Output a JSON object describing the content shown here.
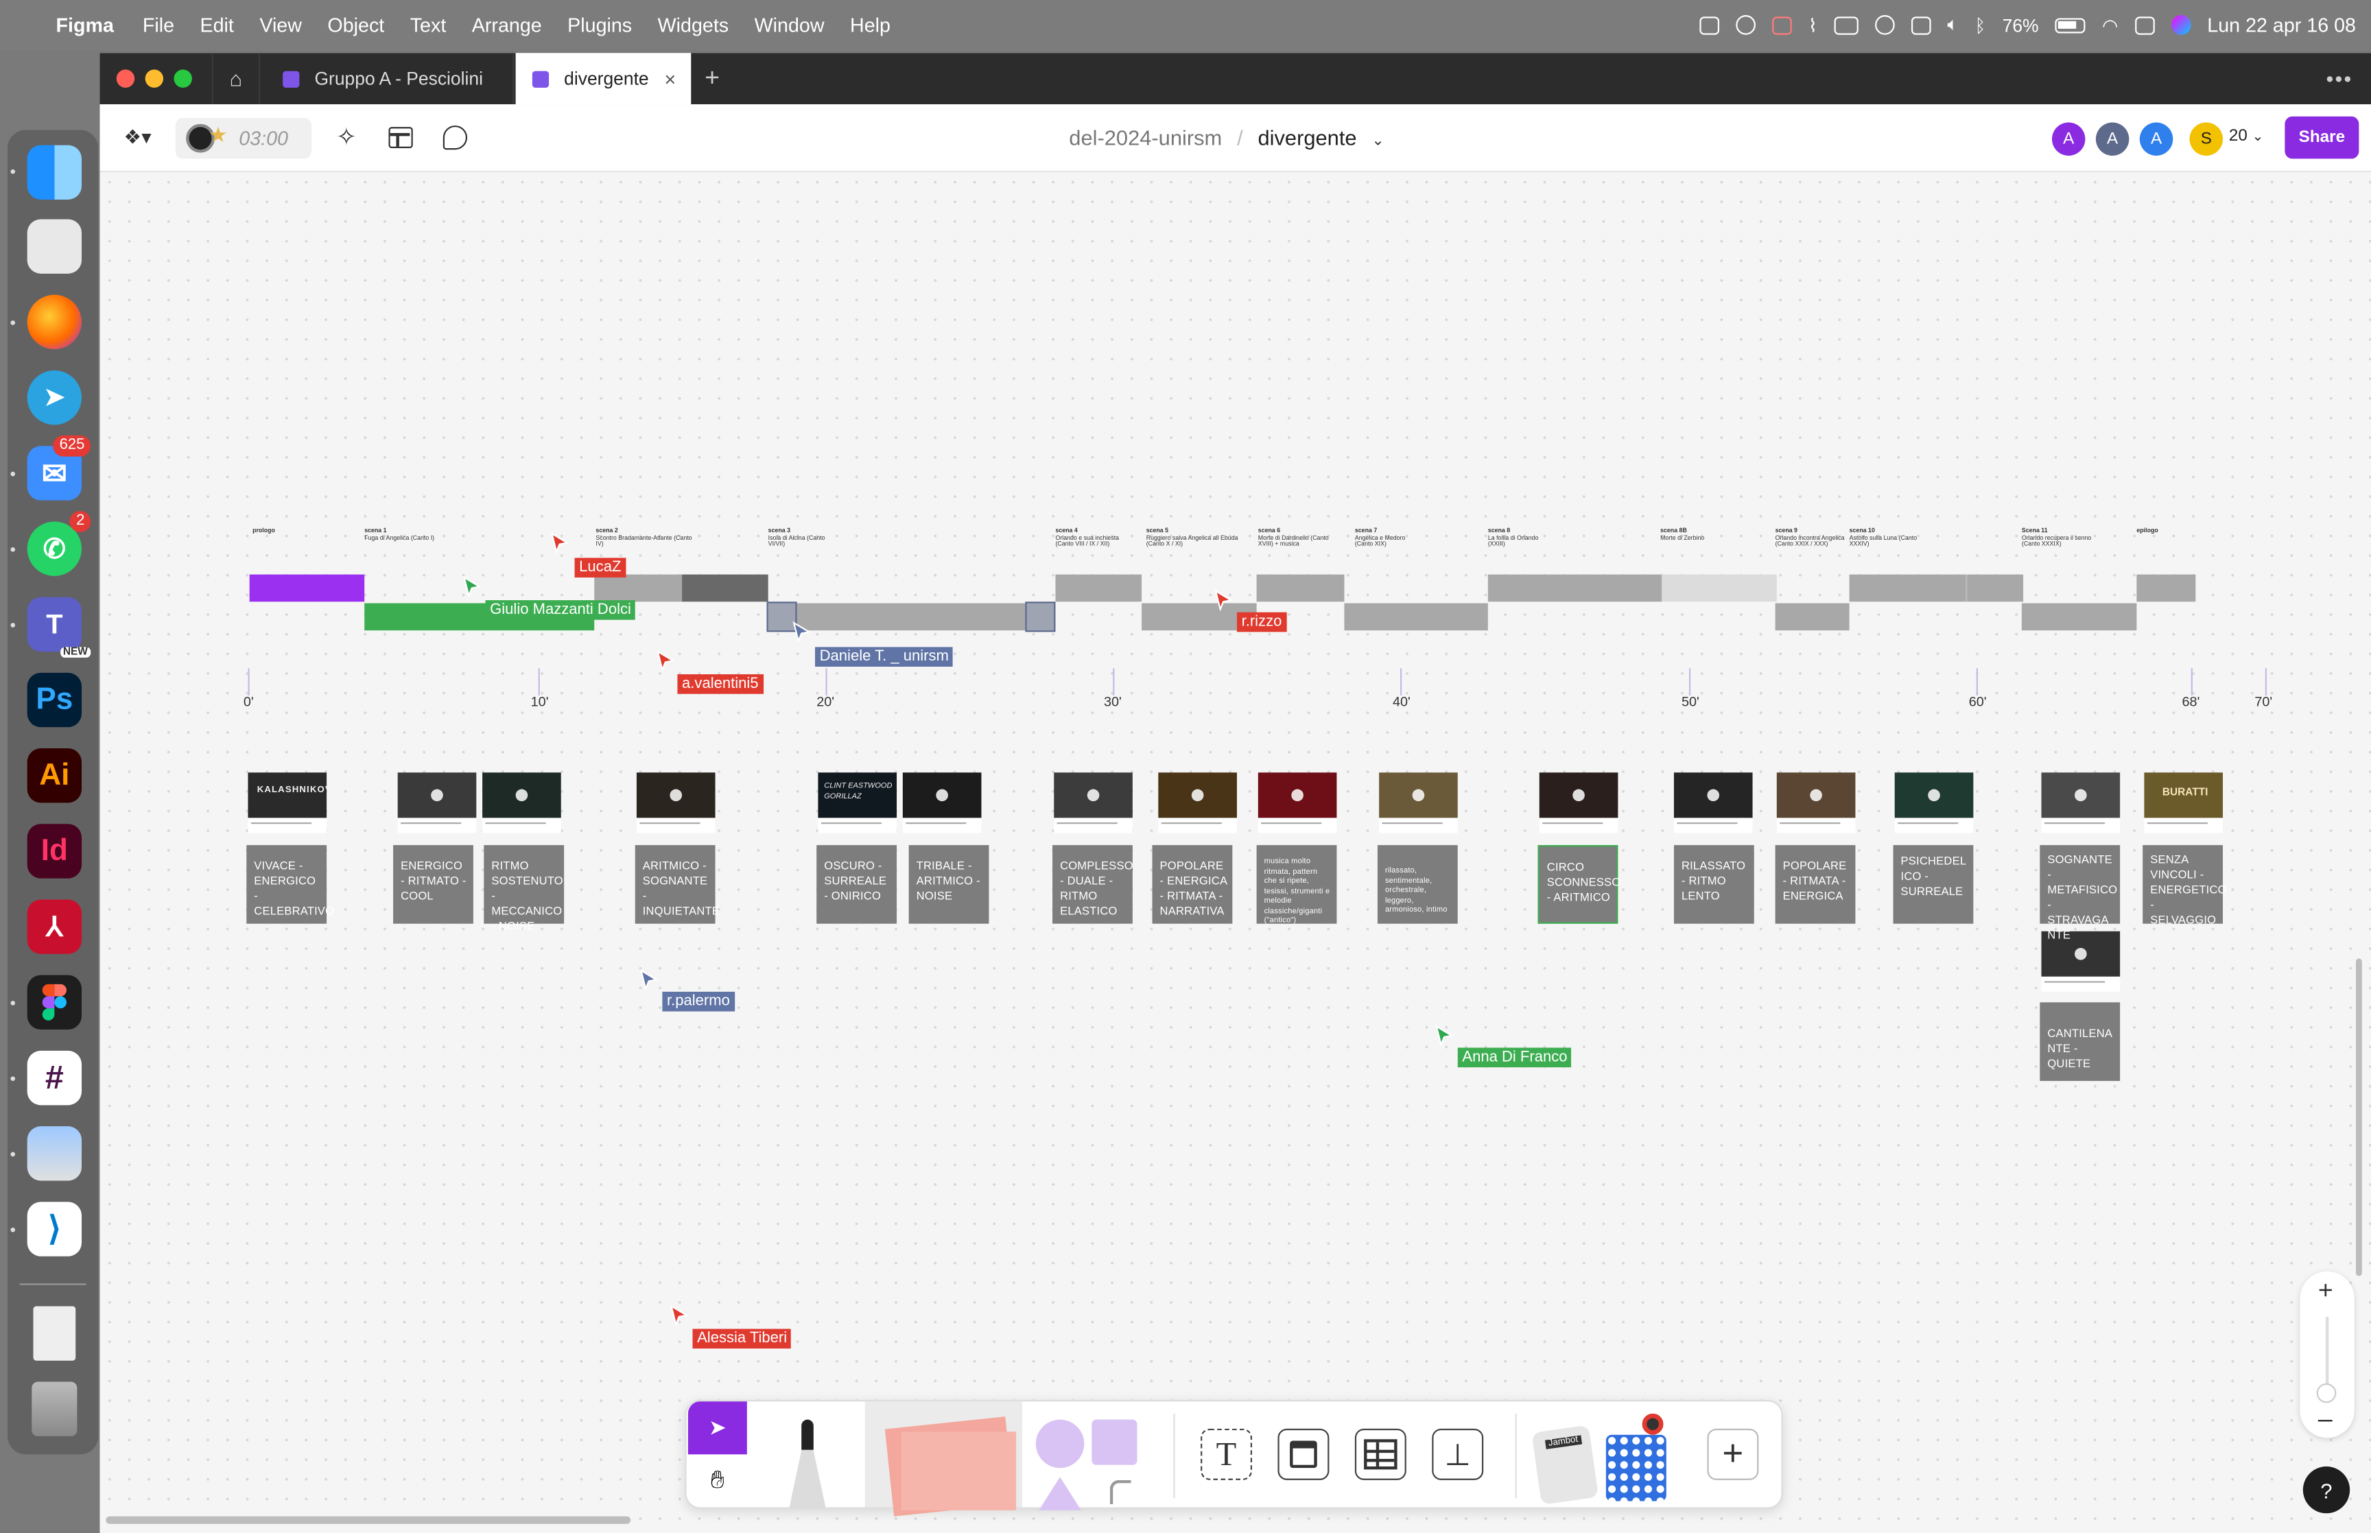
{
  "menubar": {
    "app": "Figma",
    "items": [
      "File",
      "Edit",
      "View",
      "Object",
      "Text",
      "Arrange",
      "Plugins",
      "Widgets",
      "Window",
      "Help"
    ],
    "battery": "76%",
    "datetime": "Lun 22 apr  16 08"
  },
  "dock": {
    "mail_badge": "625",
    "whatsapp_badge": "2",
    "teams_new": "NEW",
    "ps": "Ps",
    "ai": "Ai",
    "id": "Id"
  },
  "tabs": [
    {
      "label": "Gruppo A - Pesciolini"
    },
    {
      "label": "divergente"
    }
  ],
  "toolbar": {
    "timer": "03:00",
    "project": "del-2024-unirsm",
    "separator": "/",
    "file": "divergente",
    "avatars": [
      "A",
      "A",
      "A",
      "S"
    ],
    "avatar_colors": [
      "#8a2be2",
      "#5d6a8c",
      "#2f80ed",
      "#f2c100"
    ],
    "viewer_count": "20",
    "share_label": "Share"
  },
  "scenes": [
    {
      "title": "prologo",
      "sub": ""
    },
    {
      "title": "scena 1",
      "sub": "Fuga di Angelica (Canto I)"
    },
    {
      "title": "scena 2",
      "sub": "Scontro Bradamante-Atlante (Canto IV)"
    },
    {
      "title": "scena 3",
      "sub": "Isola di Alcina (Canto VI/VII)"
    },
    {
      "title": "scena 4",
      "sub": "Orlando e sua inchiesta (Canto VIII / IX / XII)"
    },
    {
      "title": "scena 5",
      "sub": "Ruggiero salva Angelica all Ebuda (Canto X / XI)"
    },
    {
      "title": "scena 6",
      "sub": "Morte di Dardinello (Canto XVIII) + musica"
    },
    {
      "title": "scena 7",
      "sub": "Angelica e Medoro (Canto XIX)"
    },
    {
      "title": "scena 8",
      "sub": "La follia di Orlando (XXIII)"
    },
    {
      "title": "scena 8B",
      "sub": "Morte di Zerbino"
    },
    {
      "title": "scena 9",
      "sub": "Orlando incontra Angelica (Canto XXIX / XXX)"
    },
    {
      "title": "scena 10",
      "sub": "Astolfo sulla Luna (Canto XXXIV)"
    },
    {
      "title": "Scena 11",
      "sub": "Orlando recupera il senno (Canto XXXIX)"
    },
    {
      "title": "epilogo",
      "sub": ""
    }
  ],
  "timeline": {
    "labels": [
      "0'",
      "10'",
      "20'",
      "30'",
      "40'",
      "50'",
      "60'",
      "68'",
      "70'"
    ]
  },
  "cards": [
    "VIVACE - ENERGICO - CELEBRATIVO",
    "ENERGICO - RITMATO - COOL",
    "RITMO SOSTENUTO - MECCANICO - NOISE",
    "ARITMICO - SOGNANTE - INQUIETANTE",
    "OSCURO - SURREALE - ONIRICO",
    "TRIBALE - ARITMICO - NOISE",
    "COMPLESSO - DUALE - RITMO ELASTICO",
    "POPOLARE - ENERGICA - RITMATA - NARRATIVA",
    "musica molto ritmata, pattern che si ripete, tesissi, strumenti e melodie classiche/giganti (\"antico\")",
    "rilassato, sentimentale, orchestrale, leggero, armonioso, intimo",
    "CIRCO SCONNESSO - ARITMICO",
    "RILASSATO - RITMO LENTO",
    "POPOLARE - RITMATA - ENERGICA",
    "PSICHEDEL ICO - SURREALE",
    "SOGNANTE - METAFISICO - STRAVAGA NTE",
    "SENZA VINCOLI - ENERGETICO - SELVAGGIO",
    "CANTILENA NTE - QUIETE"
  ],
  "thumb_titles": [
    "KALASHNIKOV",
    "CLINT EASTWOOD GORILLAZ",
    "BURATTI"
  ],
  "cursors": [
    {
      "name": "LucaZ",
      "color": "#e03a2f"
    },
    {
      "name": "Giulio Mazzanti Dolci",
      "color": "#2fa84f"
    },
    {
      "name": "a.valentini5",
      "color": "#e03a2f"
    },
    {
      "name": "Daniele T. _ unirsm",
      "color": "#6074a6"
    },
    {
      "name": "r.rizzo",
      "color": "#e03a2f"
    },
    {
      "name": "r.palermo",
      "color": "#6074a6"
    },
    {
      "name": "Anna Di Franco",
      "color": "#2fa84f"
    },
    {
      "name": "Alessia Tiberi",
      "color": "#e03a2f"
    }
  ],
  "zoom": {
    "plus": "+",
    "minus": "–"
  },
  "help": "?",
  "jambot_label": "Jambot"
}
